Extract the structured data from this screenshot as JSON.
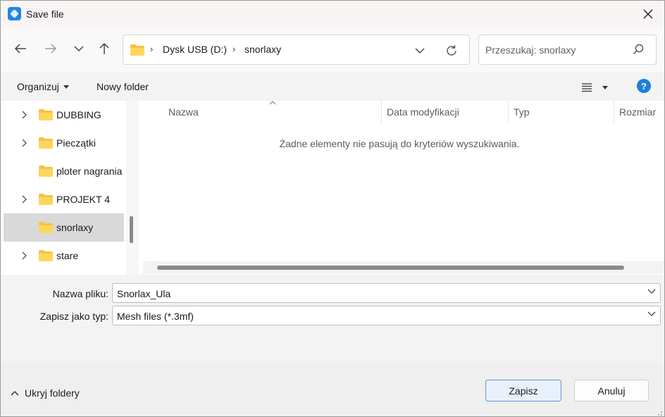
{
  "window": {
    "title": "Save file"
  },
  "addressbar": {
    "crumbs": [
      "Dysk USB (D:)",
      "snorlaxy"
    ]
  },
  "search": {
    "placeholder": "Przeszukaj: snorlaxy"
  },
  "toolbar": {
    "organize_label": "Organizuj",
    "new_folder_label": "Nowy folder",
    "help_label": "?"
  },
  "tree": {
    "items": [
      {
        "label": "DUBBING",
        "expandable": true,
        "selected": false
      },
      {
        "label": "Pieczątki",
        "expandable": true,
        "selected": false
      },
      {
        "label": "ploter nagrania",
        "expandable": false,
        "selected": false
      },
      {
        "label": "PROJEKT 4",
        "expandable": true,
        "selected": false
      },
      {
        "label": "snorlaxy",
        "expandable": false,
        "selected": true
      },
      {
        "label": "stare",
        "expandable": true,
        "selected": false
      }
    ]
  },
  "filelist": {
    "columns": [
      "Nazwa",
      "Data modyfikacji",
      "Typ",
      "Rozmiar"
    ],
    "empty_message": "Żadne elementy nie pasują do kryteriów wyszukiwania."
  },
  "form": {
    "filename_label": "Nazwa pliku:",
    "filename_value": "Snorlax_Ula",
    "filetype_label": "Zapisz jako typ:",
    "filetype_value": "Mesh files (*.3mf)"
  },
  "footer": {
    "hide_folders_label": "Ukryj foldery",
    "save_label": "Zapisz",
    "cancel_label": "Anuluj"
  }
}
